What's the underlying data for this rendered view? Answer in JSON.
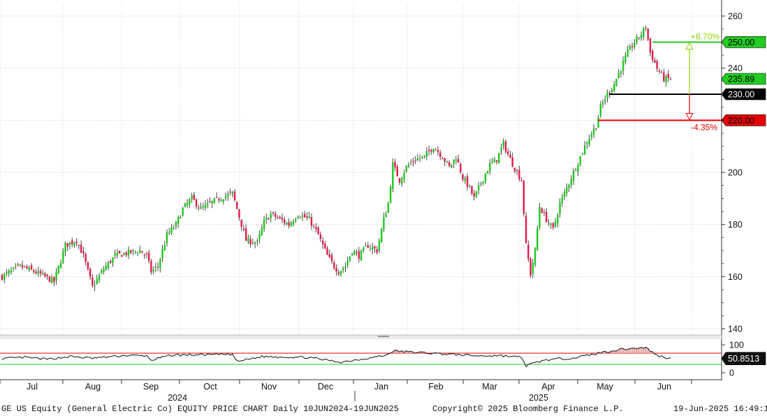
{
  "chart_data": {
    "type": "candlestick",
    "y_ticks": [
      140,
      160,
      180,
      200,
      220,
      240,
      260
    ],
    "ylim": [
      137,
      262
    ],
    "rsi_ticks": [
      100,
      50,
      0
    ],
    "months": [
      "Jul",
      "Aug",
      "Sep",
      "Oct",
      "Nov",
      "Dec",
      "Jan",
      "Feb",
      "Mar",
      "Apr",
      "May",
      "Jun"
    ],
    "years": [
      "2024",
      "2025"
    ],
    "price_anchors": [
      [
        0,
        160
      ],
      [
        8,
        164
      ],
      [
        14,
        162
      ],
      [
        19,
        160
      ],
      [
        23,
        158
      ],
      [
        28,
        172
      ],
      [
        33,
        174
      ],
      [
        36,
        168
      ],
      [
        40,
        156
      ],
      [
        45,
        163
      ],
      [
        50,
        168
      ],
      [
        55,
        169
      ],
      [
        61,
        170
      ],
      [
        64,
        168
      ],
      [
        66,
        162
      ],
      [
        69,
        164
      ],
      [
        73,
        176
      ],
      [
        77,
        180
      ],
      [
        80,
        186
      ],
      [
        84,
        190
      ],
      [
        88,
        186
      ],
      [
        92,
        188
      ],
      [
        96,
        190
      ],
      [
        102,
        192
      ],
      [
        104,
        186
      ],
      [
        108,
        174
      ],
      [
        113,
        173
      ],
      [
        116,
        181
      ],
      [
        119,
        184
      ],
      [
        123,
        182
      ],
      [
        127,
        180
      ],
      [
        131,
        184
      ],
      [
        136,
        182
      ],
      [
        140,
        176
      ],
      [
        144,
        168
      ],
      [
        147,
        164
      ],
      [
        149,
        162
      ],
      [
        152,
        164
      ],
      [
        155,
        170
      ],
      [
        158,
        168
      ],
      [
        162,
        172
      ],
      [
        166,
        170
      ],
      [
        169,
        182
      ],
      [
        171,
        188
      ],
      [
        173,
        203
      ],
      [
        176,
        197
      ],
      [
        179,
        202
      ],
      [
        183,
        205
      ],
      [
        187,
        206
      ],
      [
        191,
        210
      ],
      [
        195,
        206
      ],
      [
        198,
        202
      ],
      [
        201,
        206
      ],
      [
        204,
        198
      ],
      [
        207,
        194
      ],
      [
        209,
        190
      ],
      [
        212,
        196
      ],
      [
        216,
        203
      ],
      [
        219,
        205
      ],
      [
        222,
        211
      ],
      [
        225,
        205
      ],
      [
        228,
        200
      ],
      [
        230,
        197
      ],
      [
        232,
        172
      ],
      [
        234,
        161
      ],
      [
        236,
        170
      ],
      [
        238,
        187
      ],
      [
        241,
        182
      ],
      [
        244,
        178
      ],
      [
        247,
        188
      ],
      [
        250,
        194
      ],
      [
        253,
        200
      ],
      [
        256,
        206
      ],
      [
        259,
        212
      ],
      [
        263,
        218
      ],
      [
        265,
        225
      ],
      [
        268,
        230
      ],
      [
        271,
        234
      ],
      [
        274,
        240
      ],
      [
        277,
        246
      ],
      [
        280,
        250
      ],
      [
        283,
        253
      ],
      [
        285,
        256
      ],
      [
        287,
        246
      ],
      [
        290,
        240
      ],
      [
        293,
        236
      ],
      [
        296,
        235.89
      ]
    ],
    "rsi_anchors": [
      [
        0,
        50
      ],
      [
        10,
        55
      ],
      [
        20,
        48
      ],
      [
        30,
        58
      ],
      [
        40,
        52
      ],
      [
        55,
        62
      ],
      [
        64,
        60
      ],
      [
        66,
        45
      ],
      [
        75,
        63
      ],
      [
        85,
        64
      ],
      [
        95,
        65
      ],
      [
        102,
        66
      ],
      [
        104,
        40
      ],
      [
        115,
        58
      ],
      [
        135,
        55
      ],
      [
        150,
        38
      ],
      [
        160,
        50
      ],
      [
        170,
        62
      ],
      [
        173,
        78
      ],
      [
        190,
        70
      ],
      [
        205,
        63
      ],
      [
        212,
        60
      ],
      [
        220,
        62
      ],
      [
        230,
        55
      ],
      [
        232,
        25
      ],
      [
        240,
        45
      ],
      [
        255,
        55
      ],
      [
        265,
        72
      ],
      [
        275,
        85
      ],
      [
        285,
        90
      ],
      [
        290,
        62
      ],
      [
        296,
        50.85
      ]
    ],
    "levels": [
      {
        "value": 250.0,
        "label": "250.00",
        "color": "#22cc22"
      },
      {
        "value": 230.0,
        "label": "230.00",
        "color": "#000000"
      },
      {
        "value": 220.0,
        "label": "220.00",
        "color": "#e60000"
      }
    ],
    "last_price": {
      "value": 235.89,
      "label": "235.89"
    },
    "upside": {
      "label": "+8.70%",
      "color": "#8bd400"
    },
    "downside": {
      "label": "-4.35%",
      "color": "#e60000"
    },
    "rsi_last": {
      "value": 50.85,
      "label": "50.8513"
    },
    "rsi_upper_line": 70,
    "rsi_lower_line": 30
  },
  "footer": {
    "security": "GE US Equity (General Electric Co) EQUITY PRICE CHART  Daily 10JUN2024-19JUN2025",
    "copyright": "Copyright© 2025 Bloomberg Finance L.P.",
    "timestamp": "19-Jun-2025 16:49:12"
  }
}
